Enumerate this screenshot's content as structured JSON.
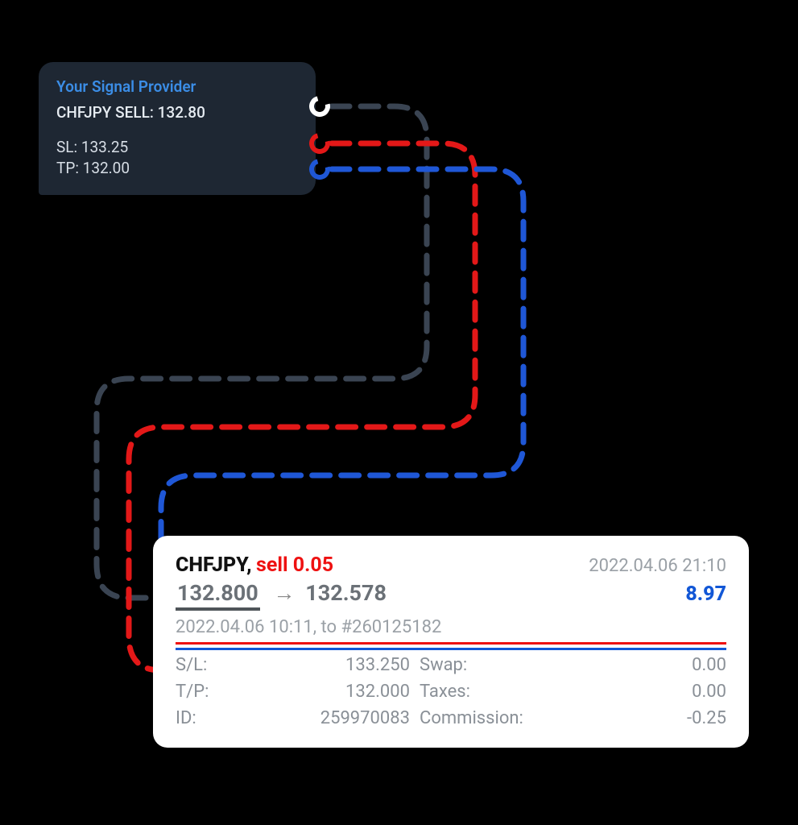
{
  "colors": {
    "entry_line": "#3a4452",
    "sl_line": "#e31818",
    "tp_line": "#1f57d6",
    "bubble_bg": "#1e2733",
    "title_accent": "#3b8de6",
    "profit": "#1257d6"
  },
  "signal": {
    "title": "Your Signal Provider",
    "main_line": "CHFJPY SELL: 132.80",
    "sl_line": "SL:  133.25",
    "tp_line": "TP:  132.00"
  },
  "trade": {
    "symbol": "CHFJPY,",
    "side_text": "sell 0.05",
    "open_time": "2022.04.06 21:10",
    "entry_price": "132.800",
    "close_price": "132.578",
    "profit": "8.97",
    "close_info": "2022.04.06 10:11, to #260125182",
    "rows": {
      "sl_label": "S/L:",
      "sl_value": "133.250",
      "swap_label": "Swap:",
      "swap_value": "0.00",
      "tp_label": "T/P:",
      "tp_value": "132.000",
      "taxes_label": "Taxes:",
      "taxes_value": "0.00",
      "id_label": "ID:",
      "id_value": "259970083",
      "comm_label": "Commission:",
      "comm_value": "-0.25"
    }
  }
}
